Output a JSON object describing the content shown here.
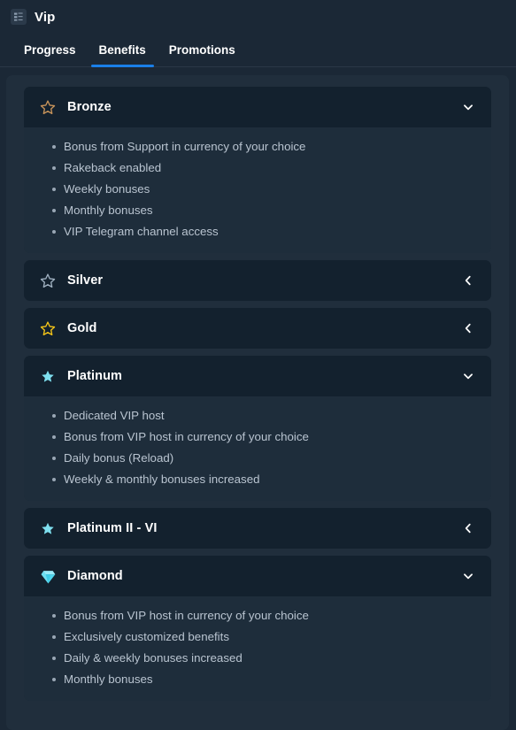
{
  "header": {
    "title": "Vip",
    "icon": "image-placeholder-icon"
  },
  "tabs": [
    {
      "label": "Progress",
      "active": false
    },
    {
      "label": "Benefits",
      "active": true
    },
    {
      "label": "Promotions",
      "active": false
    }
  ],
  "colors": {
    "page_background": "#1b2836",
    "panel_background": "#202e3c",
    "card_header_background": "#13212e",
    "card_body_background": "#1e2d3b",
    "accent_blue": "#1a7fe8",
    "bronze": "#c8945a",
    "silver": "#9fb0c0",
    "gold": "#f5c518",
    "platinum": "#7fe0f0",
    "diamond": "#4fd6ee",
    "text_primary": "#ffffff",
    "text_secondary": "#b9c4d0"
  },
  "tiers": [
    {
      "name": "Bronze",
      "icon": "star-outline-icon",
      "icon_color": "#c8945a",
      "icon_style": "outline",
      "expanded": true,
      "chevron": "chevron-down-icon",
      "benefits": [
        "Bonus from Support in currency of your choice",
        "Rakeback enabled",
        "Weekly bonuses",
        "Monthly bonuses",
        "VIP Telegram channel access"
      ]
    },
    {
      "name": "Silver",
      "icon": "star-outline-icon",
      "icon_color": "#9fb0c0",
      "icon_style": "outline",
      "expanded": false,
      "chevron": "chevron-left-icon",
      "benefits": []
    },
    {
      "name": "Gold",
      "icon": "star-outline-icon",
      "icon_color": "#f5c518",
      "icon_style": "outline",
      "expanded": false,
      "chevron": "chevron-left-icon",
      "benefits": []
    },
    {
      "name": "Platinum",
      "icon": "star-filled-icon",
      "icon_color": "#7fe0f0",
      "icon_style": "filled",
      "expanded": true,
      "chevron": "chevron-down-icon",
      "benefits": [
        "Dedicated VIP host",
        "Bonus from VIP host in currency of your choice",
        "Daily bonus (Reload)",
        "Weekly & monthly bonuses increased"
      ]
    },
    {
      "name": "Platinum II - VI",
      "icon": "star-filled-icon",
      "icon_color": "#7fe0f0",
      "icon_style": "filled",
      "expanded": false,
      "chevron": "chevron-left-icon",
      "benefits": []
    },
    {
      "name": "Diamond",
      "icon": "diamond-gem-icon",
      "icon_color": "#4fd6ee",
      "icon_style": "gem",
      "expanded": true,
      "chevron": "chevron-down-icon",
      "benefits": [
        "Bonus from VIP host in currency of your choice",
        "Exclusively customized benefits",
        "Daily & weekly bonuses increased",
        "Monthly bonuses"
      ]
    }
  ]
}
